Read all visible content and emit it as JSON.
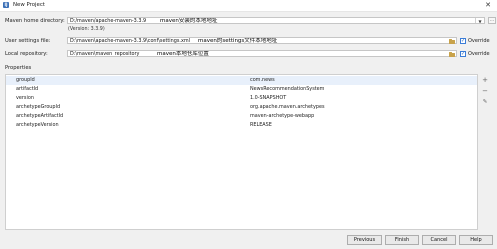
{
  "window": {
    "title": "New Project",
    "close_glyph": "✕",
    "icon": "app-icon"
  },
  "maven_home": {
    "label": "Maven home directory:",
    "value": "D:/maven/apache-maven-3.3.9",
    "annotation": "maven安装的本地地址",
    "version": "(Version: 3.3.9)",
    "browse_label": "..."
  },
  "user_settings": {
    "label": "User settings file:",
    "value": "D:\\maven\\apache-maven-3.3.9\\conf\\settings.xml",
    "annotation": "maven的settings文件本地地址",
    "override_label": "Override",
    "override_checked": true
  },
  "local_repo": {
    "label": "Local repository:",
    "value": "D:\\maven\\maven_repository",
    "annotation": "maven本地仓库位置",
    "override_label": "Override",
    "override_checked": true
  },
  "properties": {
    "title": "Properties",
    "rows": [
      {
        "key": "groupId",
        "value": "com.news"
      },
      {
        "key": "artifactId",
        "value": "NewsRecommendationSystem"
      },
      {
        "key": "version",
        "value": "1.0-SNAPSHOT"
      },
      {
        "key": "archetypeGroupId",
        "value": "org.apache.maven.archetypes"
      },
      {
        "key": "archetypeArtifactId",
        "value": "maven-archetype-webapp"
      },
      {
        "key": "archetypeVersion",
        "value": "RELEASE"
      }
    ],
    "tools": [
      "+",
      "−",
      "✎"
    ]
  },
  "footer": {
    "previous": "Previous",
    "finish": "Finish",
    "cancel": "Cancel",
    "help": "Help"
  }
}
